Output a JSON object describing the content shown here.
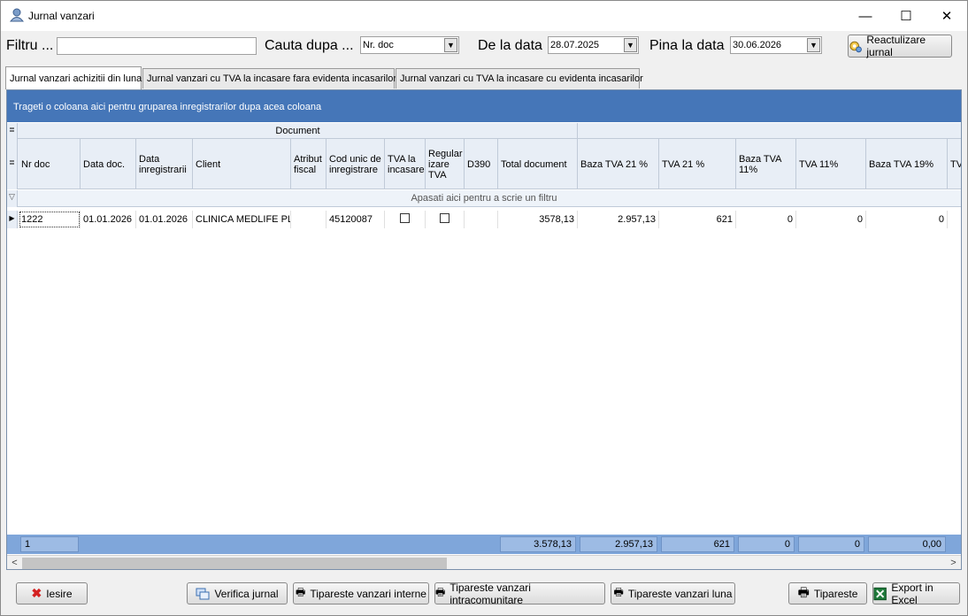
{
  "window": {
    "title": "Jurnal vanzari",
    "minimize": "—",
    "maximize": "☐",
    "close": "✕"
  },
  "filter": {
    "filtru_label": "Filtru ...",
    "filtru_value": "",
    "cauta_label": "Cauta dupa ...",
    "cauta_value": "Nr. doc",
    "de_la_label": "De la data",
    "de_la_value": "28.07.2025",
    "pina_la_label": "Pina la data",
    "pina_la_value": "30.06.2026",
    "reactualizare_label": "Reactulizare jurnal"
  },
  "tabs": [
    {
      "label": "Jurnal vanzari achizitii din luna"
    },
    {
      "label": "Jurnal vanzari cu TVA la incasare fara evidenta incasarilor"
    },
    {
      "label": "Jurnal vanzari cu TVA la incasare cu evidenta incasarilor"
    }
  ],
  "grid": {
    "group_hint": "Trageti o coloana aici pentru gruparea inregistrarilor dupa acea coloana",
    "band_document": "Document",
    "filter_hint": "Apasati aici pentru a scrie un filtru",
    "columns": [
      "Nr doc",
      "Data doc.",
      "Data inregistrarii",
      "Client",
      "Atribut fiscal",
      "Cod unic de inregistrare",
      "TVA la incasare",
      "Regular izare TVA",
      "D390",
      "Total document",
      "Baza TVA 21 %",
      "TVA 21 %",
      "Baza TVA 11%",
      "TVA 11%",
      "Baza TVA 19%",
      "TVA"
    ],
    "rows": [
      {
        "nr_doc": "1222",
        "data_doc": "01.01.2026",
        "data_inreg": "01.01.2026",
        "client": "CLINICA MEDLIFE PLU",
        "atribut": "",
        "cui": "45120087",
        "d390": "",
        "total": "3578,13",
        "baza21": "2.957,13",
        "tva21": "621",
        "baza11": "0",
        "tva11": "0",
        "baza19": "0"
      }
    ],
    "footer": {
      "count": "1",
      "total": "3.578,13",
      "baza21": "2.957,13",
      "tva21": "621",
      "baza11": "0",
      "tva11": "0",
      "baza19": "0,00"
    }
  },
  "buttons": {
    "iesire": "Iesire",
    "verifica": "Verifica jurnal",
    "tip_interne": "Tipareste vanzari interne",
    "tip_intra": "Tipareste  vanzari intracomunitare",
    "tip_luna": "Tipareste vanzari luna",
    "tipareste": "Tipareste",
    "export": "Export in Excel"
  }
}
